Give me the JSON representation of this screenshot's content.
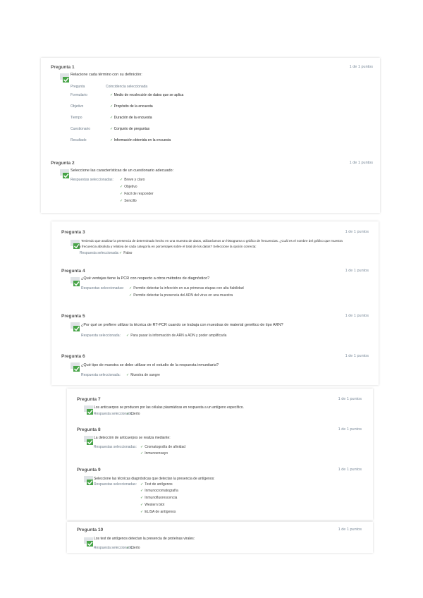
{
  "q1": {
    "title": "Pregunta 1",
    "points": "1 de 1 puntos",
    "prompt": "Relacione cada término con su definición:",
    "col_head": [
      "Pregunta",
      "Coincidencia seleccionada"
    ],
    "rows": [
      {
        "term": "Formulario",
        "answer": "Medio de recolección de datos que se aplica"
      },
      {
        "term": "Objetivo",
        "answer": "Propósito de la encuesta"
      },
      {
        "term": "Tiempo",
        "answer": "Duración de la encuesta"
      },
      {
        "term": "Cuestionario",
        "answer": "Conjunto de preguntas"
      },
      {
        "term": "Resultado",
        "answer": "Información obtenida en la encuesta"
      }
    ]
  },
  "q2": {
    "title": "Pregunta 2",
    "points": "1 de 1 puntos",
    "prompt": "Seleccione las características de un cuestionario adecuado:",
    "label": "Respuestas seleccionadas:",
    "options": [
      "Breve y claro",
      "Objetivo",
      "Fácil de responder",
      "Sencillo"
    ]
  },
  "q3": {
    "title": "Pregunta 3",
    "points": "1 de 1 puntos",
    "prompt_l1": "Teniendo que analizar la presencia de determinado hecho en una muestra de datos, utilizaríamos un histograma o gráfico de frecuencias. ¿Cuál es el nombre del gráfico que muestra",
    "prompt_l2": "la frecuencia absoluta y relativa de cada categoría en porcentajes sobre el total de los datos? Seleccione la opción correcta:",
    "label": "Respuesta seleccionada:",
    "answer": "Falso"
  },
  "q4": {
    "title": "Pregunta 4",
    "points": "1 de 1 puntos",
    "prompt": "¿Qué ventajas tiene la PCR con respecto a otros métodos de diagnóstico?",
    "label": "Respuestas seleccionadas:",
    "options": [
      "Permite detectar la infección en sus primeras etapas con alta fiabilidad",
      "Permite detectar la presencia del ADN del virus en una muestra"
    ]
  },
  "q5": {
    "title": "Pregunta 5",
    "points": "1 de 1 puntos",
    "prompt": "¿Por qué se prefiere utilizar la técnica de RT-PCR cuando se trabaja con muestras de material genético de tipo ARN?",
    "label": "Respuesta seleccionada:",
    "answer": "Para pasar la información de ARN a ADN y poder amplificarla"
  },
  "q6": {
    "title": "Pregunta 6",
    "points": "1 de 1 puntos",
    "prompt": "¿Qué tipo de muestra se debe utilizar en el estudio de la respuesta inmunitaria?",
    "label": "Respuesta seleccionada:",
    "answer": "Muestra de sangre"
  },
  "q7": {
    "title": "Pregunta 7",
    "points": "1 de 1 puntos",
    "prompt": "Los anticuerpos se producen por las células plasmáticas en respuesta a un antígeno específico.",
    "label": "Respuesta seleccionada:",
    "answer": "Cierto"
  },
  "q8": {
    "title": "Pregunta 8",
    "points": "1 de 1 puntos",
    "prompt": "La detección de anticuerpos se realiza mediante:",
    "label": "Respuestas seleccionadas:",
    "options": [
      "Cromatografía de afinidad",
      "Inmunoensayo"
    ]
  },
  "q9": {
    "title": "Pregunta 9",
    "points": "1 de 1 puntos",
    "prompt": "Seleccione las técnicas diagnósticas que detectan la presencia de antígenos:",
    "label": "Respuestas seleccionadas:",
    "options": [
      "Test de antígenos",
      "Inmunocromatografía",
      "Inmunofluorescencia",
      "Western blot",
      "ELISA de antígenos"
    ]
  },
  "q10": {
    "title": "Pregunta 10",
    "points": "1 de 1 puntos",
    "prompt": "Los test de antígenos detectan la presencia de proteínas virales:",
    "label": "Respuesta seleccionada:",
    "answer": "Cierto"
  }
}
